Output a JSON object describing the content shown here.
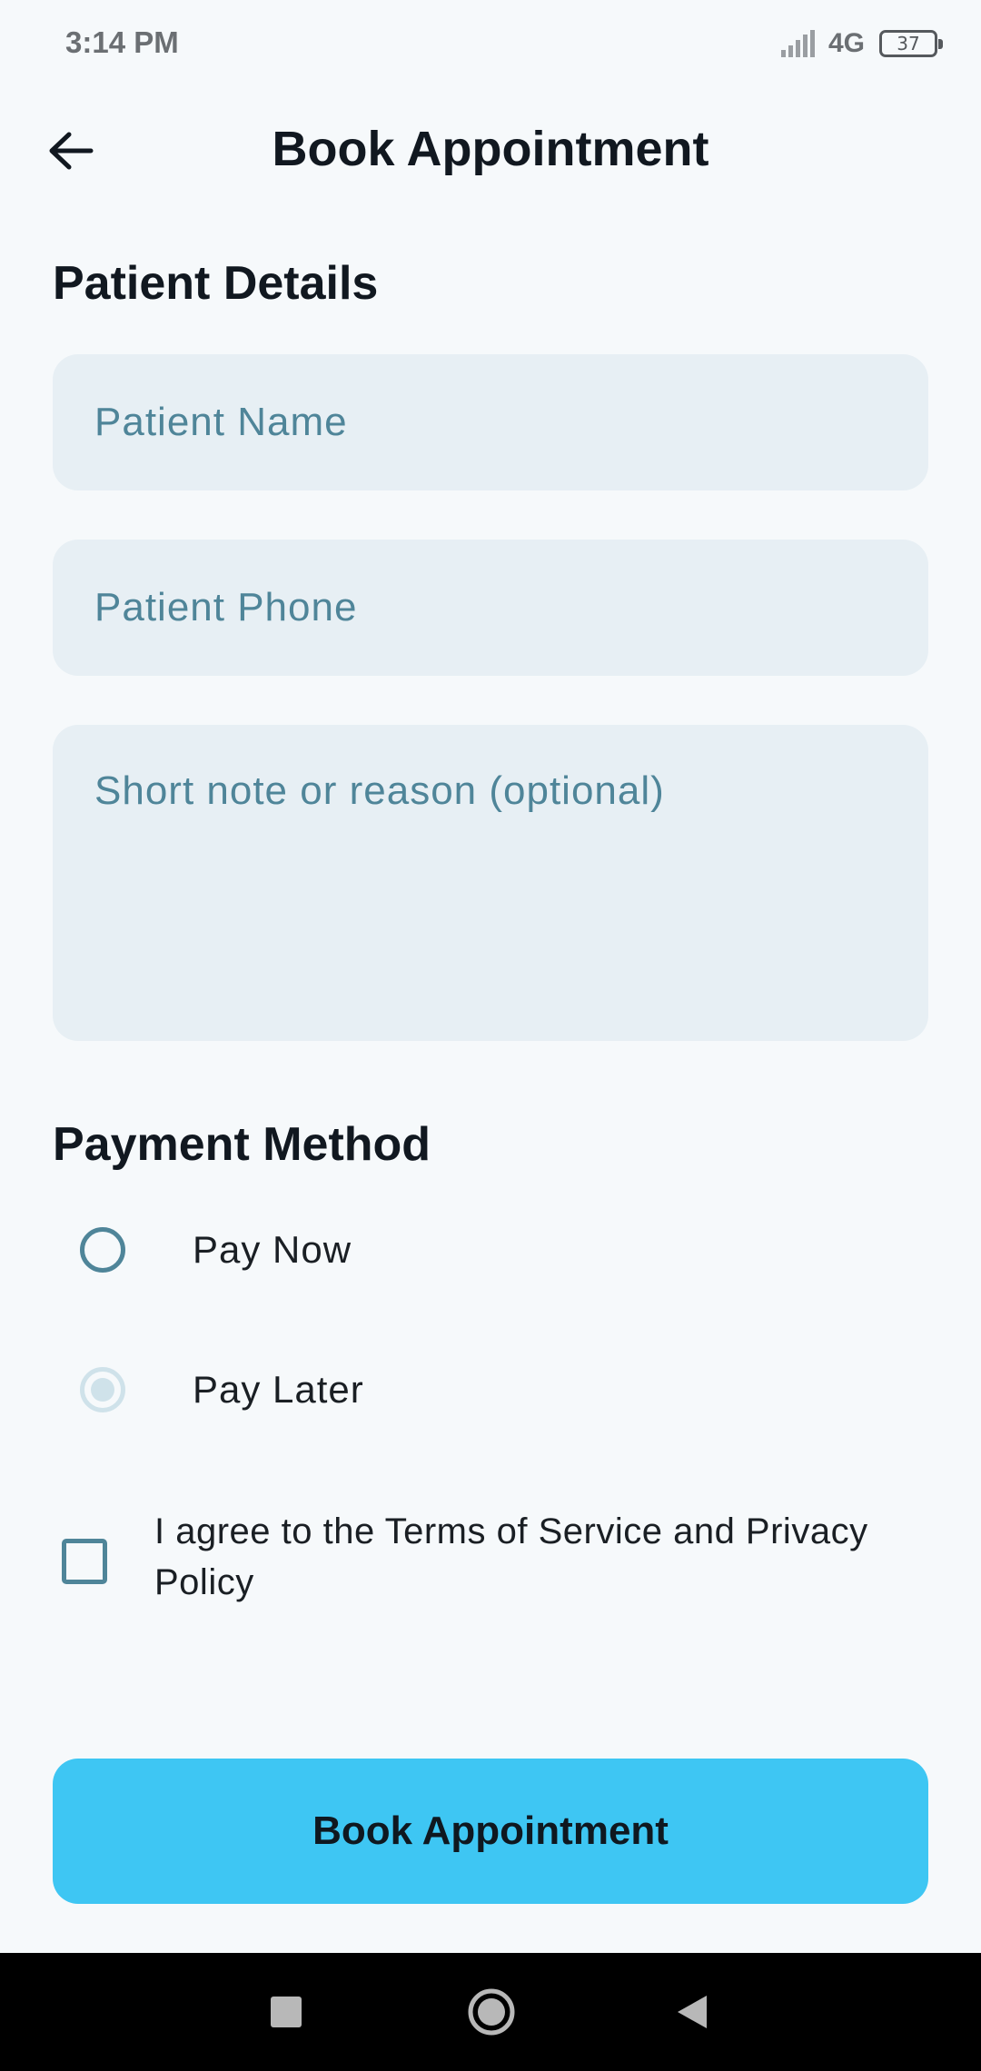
{
  "status_bar": {
    "time": "3:14 PM",
    "network": "4G",
    "battery": "37"
  },
  "app_bar": {
    "title": "Book Appointment",
    "back_icon": "arrow-left-icon"
  },
  "patient_details": {
    "heading": "Patient Details",
    "name_placeholder": "Patient Name",
    "phone_placeholder": "Patient Phone",
    "note_placeholder": "Short note or reason (optional)"
  },
  "payment": {
    "heading": "Payment Method",
    "options": [
      {
        "label": "Pay Now",
        "selected": false
      },
      {
        "label": "Pay Later",
        "selected": true
      }
    ]
  },
  "terms": {
    "label": "I agree to the Terms of Service and Privacy Policy",
    "checked": false
  },
  "submit": {
    "label": "Book Appointment",
    "color": "#3ec6f3"
  },
  "nav_bar": {
    "icons": [
      "recents-square-icon",
      "home-circle-icon",
      "back-triangle-icon"
    ]
  }
}
